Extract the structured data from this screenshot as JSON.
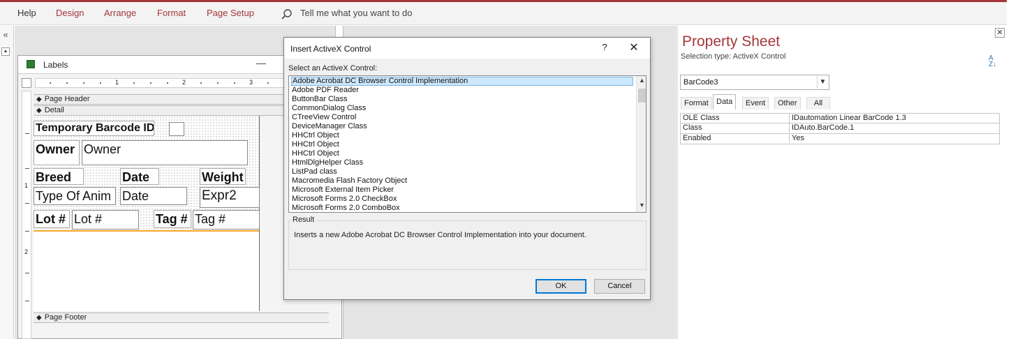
{
  "ribbon": {
    "menu": [
      "Help",
      "Design",
      "Arrange",
      "Format",
      "Page Setup"
    ],
    "tell_me": "Tell me what you want to do"
  },
  "nav": {
    "collapse_glyph": "«"
  },
  "form_window": {
    "title": "Labels",
    "minimize_glyph": "—",
    "ruler_numbers": [
      "1",
      "2",
      "3"
    ],
    "vruler_numbers": [
      "1",
      "2"
    ],
    "sections": {
      "page_header": "Page Header",
      "detail": "Detail",
      "page_footer": "Page Footer"
    },
    "controls": {
      "temp_barcode_label": "Temporary Barcode ID",
      "owner_label": "Owner",
      "owner_field": "Owner",
      "breed_label": "Breed",
      "date_label": "Date",
      "weight_label": "Weight",
      "type_field": "Type Of Anim",
      "date_field": "Date",
      "expr_field": "Expr2",
      "lot_label": "Lot #",
      "lot_field": "Lot #",
      "tag_label": "Tag #",
      "tag_field": "Tag #"
    }
  },
  "dialog": {
    "title": "Insert ActiveX Control",
    "help_glyph": "?",
    "close_glyph": "✕",
    "select_label": "Select an ActiveX Control:",
    "items": [
      "Adobe Acrobat DC Browser Control Implementation",
      "Adobe PDF Reader",
      "ButtonBar Class",
      "CommonDialog Class",
      "CTreeView Control",
      "DeviceManager Class",
      "HHCtrl Object",
      "HHCtrl Object",
      "HHCtrl Object",
      "HtmlDlgHelper Class",
      "ListPad class",
      "Macromedia Flash Factory Object",
      "Microsoft External Item Picker",
      "Microsoft Forms 2.0 CheckBox",
      "Microsoft Forms 2.0 ComboBox"
    ],
    "result_title": "Result",
    "result_text": "Inserts a new Adobe Acrobat DC Browser Control Implementation into your document.",
    "ok": "OK",
    "cancel": "Cancel"
  },
  "property_sheet": {
    "title": "Property Sheet",
    "selection_type": "Selection type:  ActiveX Control",
    "sort_glyph": "A\nZ",
    "object": "BarCode3",
    "tabs": [
      "Format",
      "Data",
      "Event",
      "Other",
      "All"
    ],
    "active_tab": "Data",
    "rows": [
      {
        "name": "OLE Class",
        "value": "IDautomation Linear BarCode 1.3"
      },
      {
        "name": "Class",
        "value": "IDAuto.BarCode.1"
      },
      {
        "name": "Enabled",
        "value": "Yes"
      }
    ]
  },
  "colors": {
    "accent": "#a4373a",
    "selection": "#cce8ff",
    "focus": "#0078d7"
  }
}
